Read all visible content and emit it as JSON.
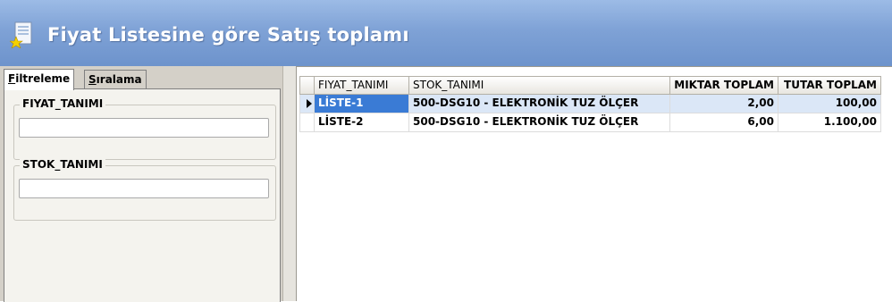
{
  "window": {
    "title": "Fiyat Listesine göre Satış toplamı"
  },
  "tabs": [
    {
      "prefix": "",
      "underline": "F",
      "rest": "iltreleme",
      "active": true
    },
    {
      "prefix": "",
      "underline": "S",
      "rest": "ıralama",
      "active": false
    }
  ],
  "filters": [
    {
      "label": "FIYAT_TANIMI",
      "value": ""
    },
    {
      "label": "STOK_TANIMI",
      "value": ""
    }
  ],
  "grid": {
    "columns": [
      "FIYAT_TANIMI",
      "STOK_TANIMI",
      "MIKTAR TOPLAM",
      "TUTAR TOPLAM"
    ],
    "rows": [
      {
        "fiyat": "LİSTE-1",
        "stok": "500-DSG10 - ELEKTRONİK TUZ ÖLÇER",
        "miktar": "2,00",
        "tutar": "100,00"
      },
      {
        "fiyat": "LİSTE-2",
        "stok": "500-DSG10 - ELEKTRONİK TUZ ÖLÇER",
        "miktar": "6,00",
        "tutar": "1.100,00"
      }
    ]
  },
  "colors": {
    "header_top": "#9cbbe6",
    "header_bottom": "#6d93cc",
    "selection": "#3a7bd5"
  },
  "icons": {
    "window_icon": "document-star-icon",
    "row_indicator": "row-pointer-icon"
  }
}
